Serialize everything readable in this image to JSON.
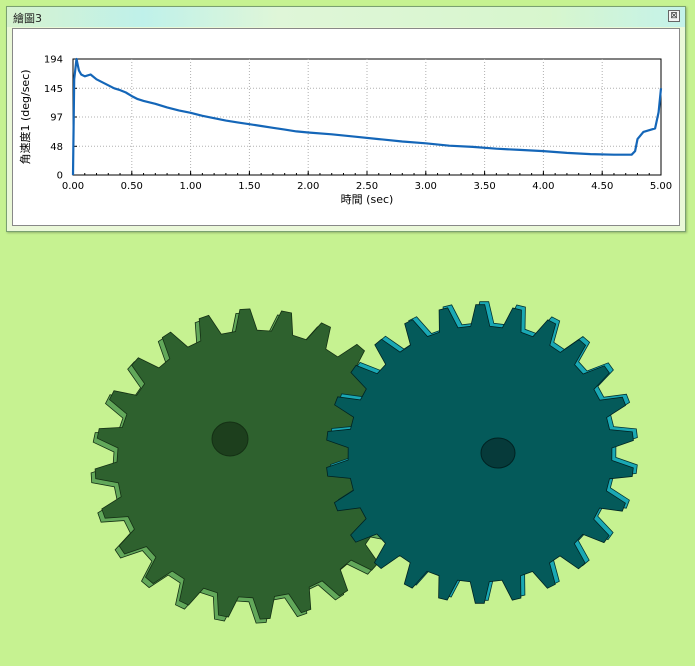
{
  "window": {
    "title": "繪圖3",
    "close_label": "⊠"
  },
  "chart_data": {
    "type": "line",
    "title": "",
    "xlabel": "時間 (sec)",
    "ylabel": "角速度1 (deg/sec)",
    "xlim": [
      0,
      5
    ],
    "ylim": [
      0,
      194
    ],
    "x_ticks": [
      "0.00",
      "0.50",
      "1.00",
      "1.50",
      "2.00",
      "2.50",
      "3.00",
      "3.50",
      "4.00",
      "4.50",
      "5.00"
    ],
    "y_ticks": [
      "0",
      "48",
      "97",
      "145",
      "194"
    ],
    "grid": true,
    "series": [
      {
        "color": "#1466b8",
        "x": [
          0.0,
          0.01,
          0.03,
          0.05,
          0.07,
          0.1,
          0.15,
          0.2,
          0.25,
          0.3,
          0.35,
          0.4,
          0.45,
          0.5,
          0.55,
          0.6,
          0.7,
          0.8,
          0.9,
          1.0,
          1.1,
          1.2,
          1.3,
          1.4,
          1.5,
          1.6,
          1.7,
          1.8,
          1.9,
          2.0,
          2.2,
          2.4,
          2.6,
          2.8,
          3.0,
          3.2,
          3.4,
          3.6,
          3.8,
          4.0,
          4.2,
          4.4,
          4.6,
          4.75,
          4.78,
          4.8,
          4.85,
          4.9,
          4.95,
          4.98,
          5.0
        ],
        "y": [
          0,
          160,
          194,
          175,
          168,
          165,
          168,
          160,
          155,
          150,
          145,
          142,
          138,
          132,
          127,
          124,
          119,
          113,
          108,
          104,
          99,
          95,
          91,
          88,
          85,
          82,
          79,
          76,
          73,
          71,
          68,
          64,
          60,
          56,
          53,
          49,
          47,
          44,
          42,
          40,
          37,
          35,
          34,
          34,
          40,
          60,
          72,
          75,
          78,
          105,
          145
        ]
      }
    ]
  },
  "scene": {
    "background": "#c6f291",
    "gear_left": {
      "color": "#2e612e",
      "edge": "#62a85a"
    },
    "gear_right": {
      "color": "#045a5a",
      "edge": "#1aa8b4"
    }
  }
}
